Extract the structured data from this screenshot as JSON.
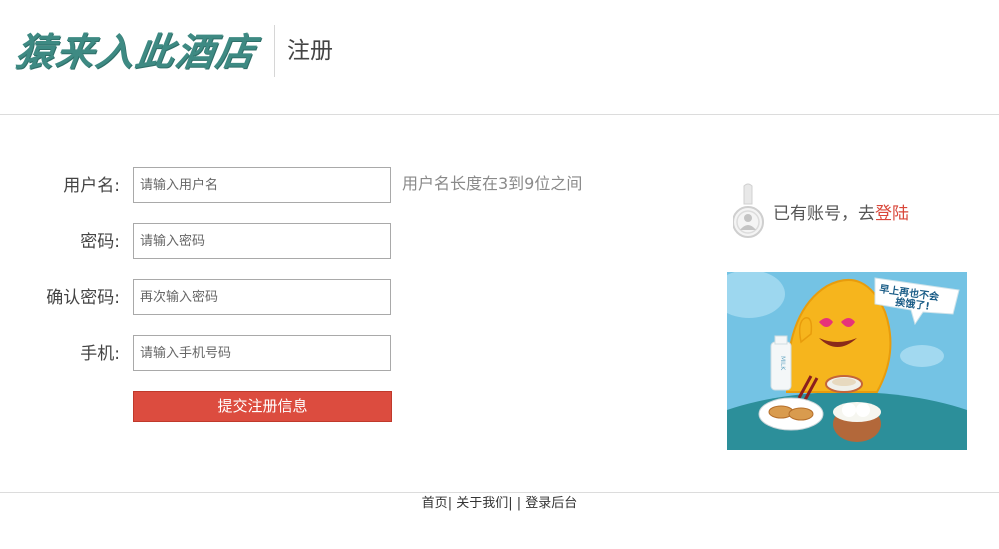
{
  "header": {
    "logo_text": "猿来入此酒店",
    "page_title": "注册"
  },
  "form": {
    "fields": [
      {
        "label": "用户名:",
        "placeholder": "请输入用户名",
        "hint": "用户名长度在3到9位之间"
      },
      {
        "label": "密码:",
        "placeholder": "请输入密码"
      },
      {
        "label": "确认密码:",
        "placeholder": "再次输入密码"
      },
      {
        "label": "手机:",
        "placeholder": "请输入手机号码"
      }
    ],
    "submit_label": "提交注册信息"
  },
  "login_prompt": {
    "text": "已有账号，去",
    "link": "登陆"
  },
  "promo": {
    "bubble_line1": "早上再也不会",
    "bubble_line2": "挨饿了!",
    "milk_label": "MILK"
  },
  "footer": {
    "links": [
      "首页",
      "关于我们",
      "登录后台"
    ],
    "separator": "|"
  },
  "colors": {
    "logo": "#3e8a83",
    "submit_bg": "#dc4c3f",
    "link": "#d9473a"
  }
}
